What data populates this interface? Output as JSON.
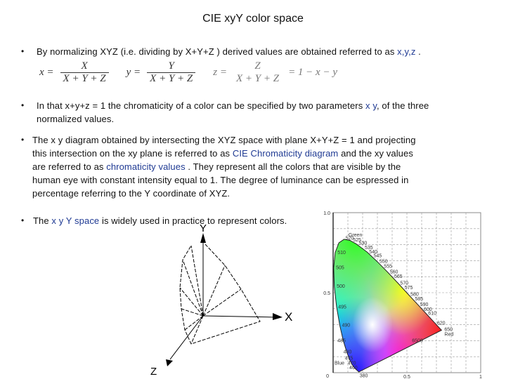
{
  "title": "CIE xyY color space",
  "bullets": [
    {
      "symbol": "•",
      "text_before": "By normalizing XYZ (i.e. dividing by  X+Y+Z ) derived values are obtained referred to as ",
      "highlight": "x,y,z",
      "text_after": " ."
    },
    {
      "symbol": "•",
      "line1_before": "In that  x+y+z = 1   the chromaticity of a color can be specified by two parameters ",
      "highlight": "x y",
      "line1_after": ", of the three",
      "line2": "normalized values."
    },
    {
      "symbol": "•",
      "line1": "The x y diagram obtained by intersecting the XYZ space with plane   X+Y+Z = 1 and projecting",
      "line2_before": "this intersection on the xy plane is referred to as ",
      "highlight1": "CIE Chromaticity diagram",
      "line2_after": " and the xy values",
      "line3_before": "are referred to as ",
      "highlight2": "chromaticity values",
      "line3_after": " . They represent all the colors that are visible by the",
      "line4": "human eye with constant intensity equal to 1. The degree of  luminance can be espressed in",
      "line5": "percentage referring to the Y coordinate of XYZ."
    },
    {
      "symbol": "•",
      "text_before": "The ",
      "highlight": "x y Y space",
      "text_after": " is widely used in practice to represent colors."
    }
  ],
  "formulas": {
    "x": {
      "lhs": "x =",
      "num": "X",
      "den": "X + Y + Z"
    },
    "y": {
      "lhs": "y =",
      "num": "Y",
      "den": "X + Y + Z"
    },
    "z": {
      "lhs": "z =",
      "num": "Z",
      "den": "X + Y + Z",
      "rhs": "= 1 − x − y"
    }
  },
  "xyz_diagram": {
    "axis_x": "X",
    "axis_y": "Y",
    "axis_z": "Z"
  },
  "chromaticity_diagram": {
    "y_ticks": [
      "1.0",
      "0.5",
      "0"
    ],
    "x_ticks": [
      "0.5",
      "1"
    ],
    "labels": [
      "Green",
      "520",
      "525",
      "530",
      "535",
      "540",
      "545",
      "550",
      "555",
      "560",
      "565",
      "570",
      "575",
      "580",
      "585",
      "590",
      "600",
      "610",
      "620",
      "650",
      "Red",
      "6500",
      "510",
      "505",
      "500",
      "495",
      "490",
      "485",
      "480",
      "475",
      "470",
      "460",
      "Blue",
      "380"
    ],
    "colors": {
      "green": "#33ff22",
      "red": "#ff1a1a",
      "blue": "#2a1aff",
      "white": "#ffffff"
    }
  }
}
